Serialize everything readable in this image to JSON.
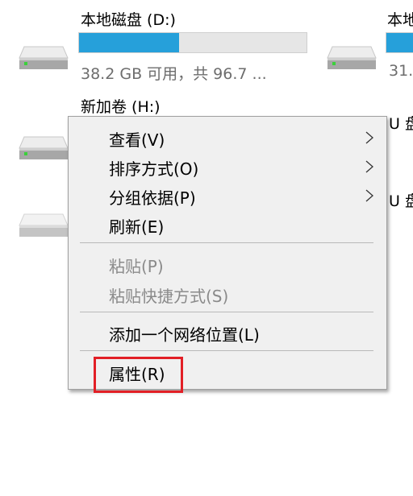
{
  "drives": [
    {
      "title": "本地磁盘 (D:)",
      "usage": 0.44,
      "subtitle": "38.2 GB 可用，共 96.7 ..."
    },
    {
      "title": "本地",
      "usage": 1.0,
      "subtitle": "31."
    },
    {
      "title": "新加卷 (H:)"
    },
    {
      "title": "U 盘"
    },
    {
      "title": "U 盘"
    }
  ],
  "context_menu": {
    "items": [
      {
        "label": "查看(V)",
        "has_submenu": true,
        "enabled": true
      },
      {
        "label": "排序方式(O)",
        "has_submenu": true,
        "enabled": true
      },
      {
        "label": "分组依据(P)",
        "has_submenu": true,
        "enabled": true
      },
      {
        "label": "刷新(E)",
        "has_submenu": false,
        "enabled": true
      },
      {
        "label": "粘贴(P)",
        "has_submenu": false,
        "enabled": false
      },
      {
        "label": "粘贴快捷方式(S)",
        "has_submenu": false,
        "enabled": false
      },
      {
        "label": "添加一个网络位置(L)",
        "has_submenu": false,
        "enabled": true
      },
      {
        "label": "属性(R)",
        "has_submenu": false,
        "enabled": true,
        "highlighted": true
      }
    ]
  },
  "colors": {
    "usage_bar": "#26a0da",
    "highlight_box": "#e21f26"
  }
}
